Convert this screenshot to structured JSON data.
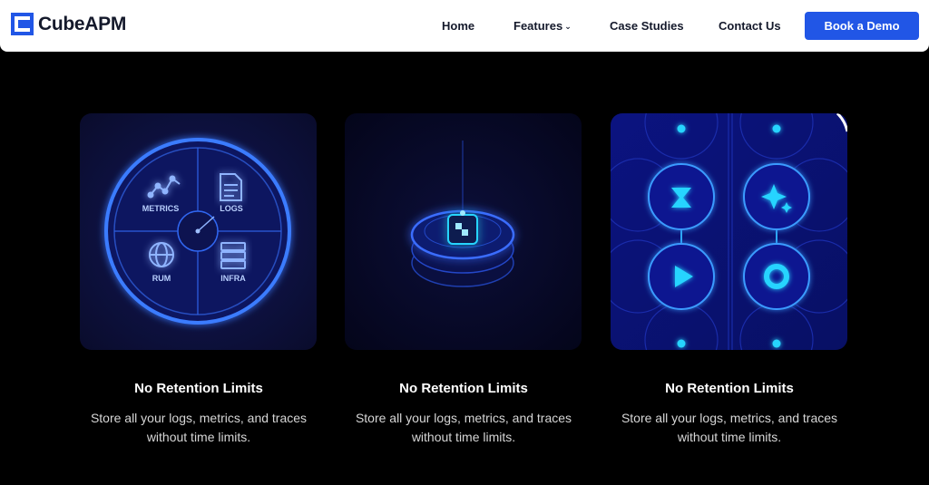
{
  "brand": {
    "name": "CubeAPM"
  },
  "nav": {
    "items": [
      {
        "label": "Home",
        "name": "nav-home"
      },
      {
        "label": "Features",
        "name": "nav-features",
        "has_dropdown": true
      },
      {
        "label": "Case Studies",
        "name": "nav-case-studies"
      },
      {
        "label": "Contact Us",
        "name": "nav-contact-us"
      }
    ],
    "cta_label": "Book a Demo"
  },
  "colors": {
    "cta": "#2156e6",
    "page_bg": "#000000",
    "glow_blue": "#2f6bff",
    "glow_cyan": "#1ee6ff"
  },
  "cards": [
    {
      "title": "No Retention Limits",
      "desc_line1": "Store all your logs, metrics, and traces",
      "desc_line2": "without time limits.",
      "image": {
        "icons": [
          "metrics-chart-icon",
          "logs-document-icon",
          "rum-globe-icon",
          "infra-server-icon"
        ],
        "labels": [
          "METRICS",
          "LOGS",
          "RUM",
          "INFRA"
        ]
      }
    },
    {
      "title": "No Retention Limits",
      "desc_line1": "Store all your logs, metrics, and traces",
      "desc_line2": "without time limits.",
      "image": {
        "icons": [
          "storage-disk-icon"
        ]
      }
    },
    {
      "title": "No Retention Limits",
      "desc_line1": "Store all your logs, metrics, and traces",
      "desc_line2": "without time limits.",
      "image": {
        "icons": [
          "hourglass-icon",
          "sparkle-icon",
          "play-icon",
          "circle-icon"
        ]
      }
    }
  ]
}
